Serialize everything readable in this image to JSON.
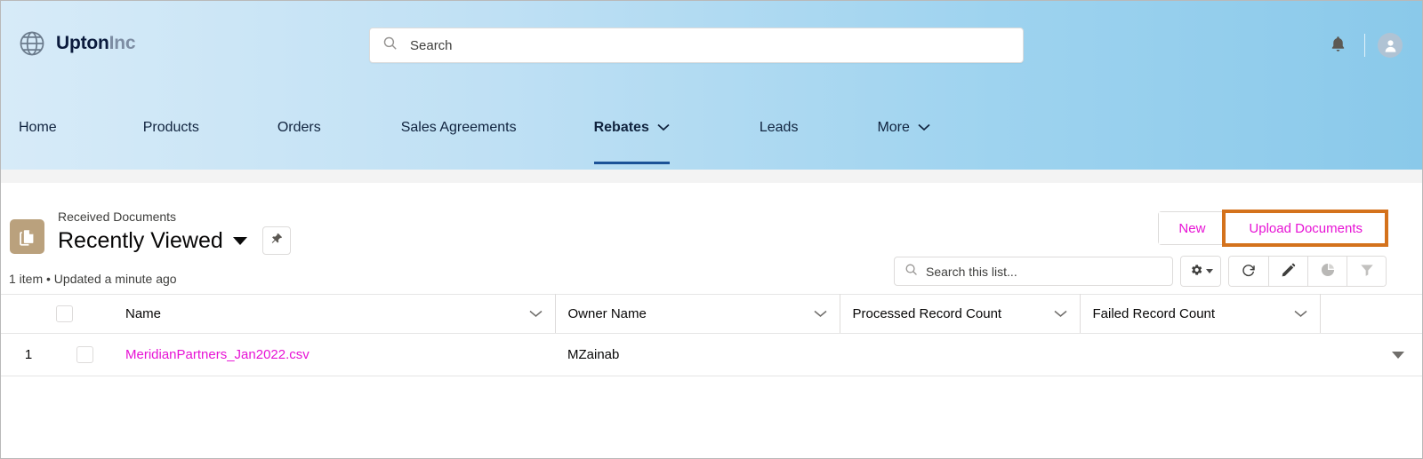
{
  "brand": {
    "name_primary": "Upton",
    "name_secondary": "Inc",
    "globe_icon": "globe-icon"
  },
  "search": {
    "placeholder": "Search",
    "value": "",
    "icon": "search-icon"
  },
  "header_icons": {
    "notifications": "bell-icon",
    "avatar": "user-avatar-icon"
  },
  "nav": {
    "items": [
      {
        "label": "Home",
        "active": false,
        "has_menu": false
      },
      {
        "label": "Products",
        "active": false,
        "has_menu": false
      },
      {
        "label": "Orders",
        "active": false,
        "has_menu": false
      },
      {
        "label": "Sales Agreements",
        "active": false,
        "has_menu": false
      },
      {
        "label": "Rebates",
        "active": true,
        "has_menu": true
      },
      {
        "label": "Leads",
        "active": false,
        "has_menu": false
      },
      {
        "label": "More",
        "active": false,
        "has_menu": true
      }
    ]
  },
  "listview": {
    "object_label": "Received Documents",
    "view_name": "Recently Viewed",
    "meta": "1 item • Updated a minute ago",
    "object_icon": "documents-icon",
    "pin_icon": "pin-icon",
    "buttons": [
      {
        "label": "New",
        "highlighted": false
      },
      {
        "label": "Upload Documents",
        "highlighted": true
      }
    ],
    "list_search": {
      "placeholder": "Search this list...",
      "value": ""
    },
    "tools": [
      {
        "name": "list-view-controls",
        "icon": "gear-icon",
        "has_caret": true
      },
      {
        "name": "refresh",
        "icon": "refresh-icon",
        "has_caret": false
      },
      {
        "name": "edit",
        "icon": "pencil-icon",
        "has_caret": false
      },
      {
        "name": "charts",
        "icon": "pie-chart-icon",
        "has_caret": false
      },
      {
        "name": "filters",
        "icon": "filter-icon",
        "has_caret": false
      }
    ],
    "columns": [
      {
        "label": "Name"
      },
      {
        "label": "Owner Name"
      },
      {
        "label": "Processed Record Count"
      },
      {
        "label": "Failed Record Count"
      }
    ],
    "rows": [
      {
        "number": "1",
        "name": "MeridianPartners_Jan2022.csv",
        "owner_name": "MZainab",
        "processed_record_count": "",
        "failed_record_count": ""
      }
    ]
  },
  "colors": {
    "link": "#e713d5",
    "highlight_border": "#d4721c",
    "active_tab_underline": "#1b5297",
    "object_icon_bg": "#baa17d"
  }
}
